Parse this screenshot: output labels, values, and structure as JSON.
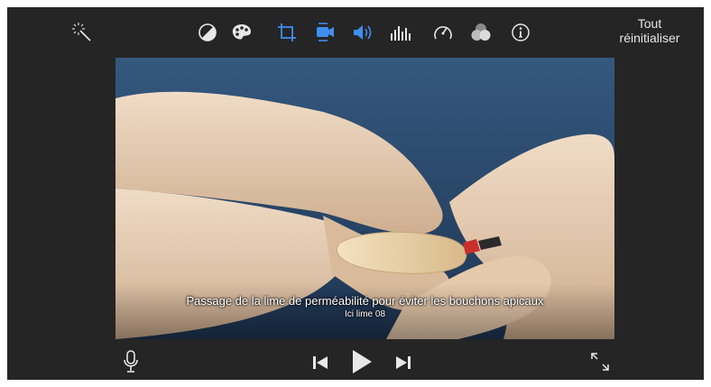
{
  "toolbar": {
    "tools": [
      {
        "name": "magic-wand-icon"
      },
      {
        "name": "color-balance-icon"
      },
      {
        "name": "color-palette-icon"
      },
      {
        "name": "crop-icon"
      },
      {
        "name": "stabilization-icon",
        "active": true
      },
      {
        "name": "volume-icon",
        "active": true
      },
      {
        "name": "equalizer-icon"
      },
      {
        "name": "speed-icon"
      },
      {
        "name": "video-overlay-icon"
      },
      {
        "name": "info-icon"
      }
    ],
    "reset_label_line1": "Tout",
    "reset_label_line2": "réinitialiser"
  },
  "viewer": {
    "subtitle": "Passage de la lime de perméabilité pour éviter les bouchons apicaux",
    "subtitle_secondary": "Ici lime 08"
  },
  "controls": {
    "mic": "microphone-icon",
    "prev": "skip-back-icon",
    "play": "play-icon",
    "next": "skip-forward-icon",
    "fullscreen": "fullscreen-icon"
  },
  "colors": {
    "background": "#252526",
    "icon": "#e8e8e8",
    "accent": "#3f8ef0",
    "backdrop": "#2a4566",
    "glove": "#e7cdb3"
  }
}
